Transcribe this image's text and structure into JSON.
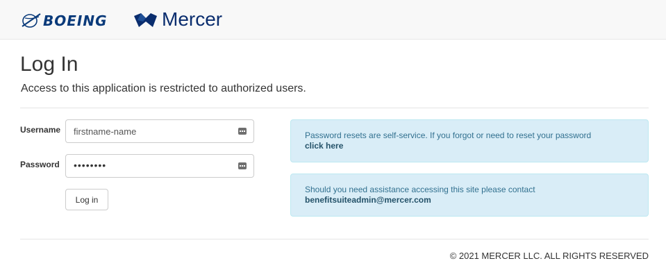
{
  "header": {
    "boeing_logo_text": "BOEING",
    "mercer_logo_text": "Mercer"
  },
  "page": {
    "title": "Log In",
    "subtitle": "Access to this application is restricted to authorized users."
  },
  "form": {
    "username_label": "Username",
    "username_value": "firstname-name",
    "password_label": "Password",
    "password_value": "••••••••",
    "submit_label": "Log in",
    "field_icon": "password-manager-key-icon"
  },
  "info": {
    "reset_text": "Password resets are self-service. If you forgot or need to reset your password",
    "reset_link": "click here",
    "contact_text": "Should you need assistance accessing this site please contact",
    "contact_email": "benefitsuiteadmin@mercer.com"
  },
  "footer": {
    "copyright": "© 2021 MERCER LLC. ALL RIGHTS RESERVED"
  },
  "colors": {
    "info_bg": "#d9edf7",
    "info_text": "#31708f",
    "boeing_blue": "#0a3a7a",
    "mercer_blue": "#0a2d6e"
  }
}
